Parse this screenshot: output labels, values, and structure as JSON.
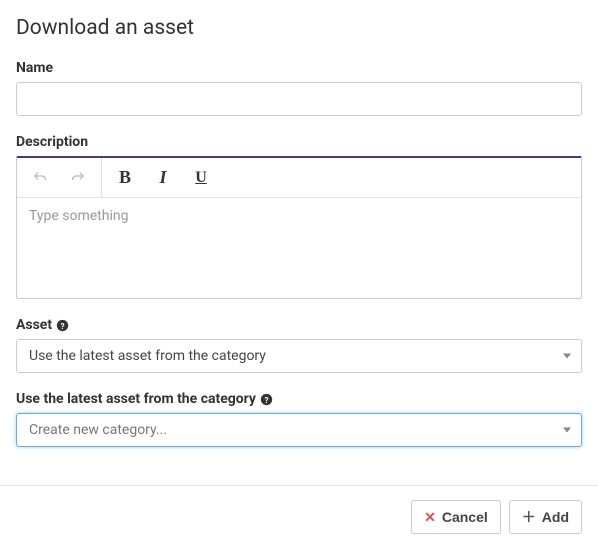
{
  "title": "Download an asset",
  "fields": {
    "name": {
      "label": "Name",
      "value": ""
    },
    "description": {
      "label": "Description",
      "placeholder": "Type something",
      "value": ""
    },
    "asset": {
      "label": "Asset",
      "selected": "Use the latest asset from the category"
    },
    "category": {
      "label": "Use the latest asset from the category",
      "selected": "Create new category..."
    }
  },
  "toolbar": {
    "undo": "Undo",
    "redo": "Redo",
    "bold": "B",
    "italic": "I",
    "underline": "U"
  },
  "footer": {
    "cancel": "Cancel",
    "add": "Add"
  }
}
